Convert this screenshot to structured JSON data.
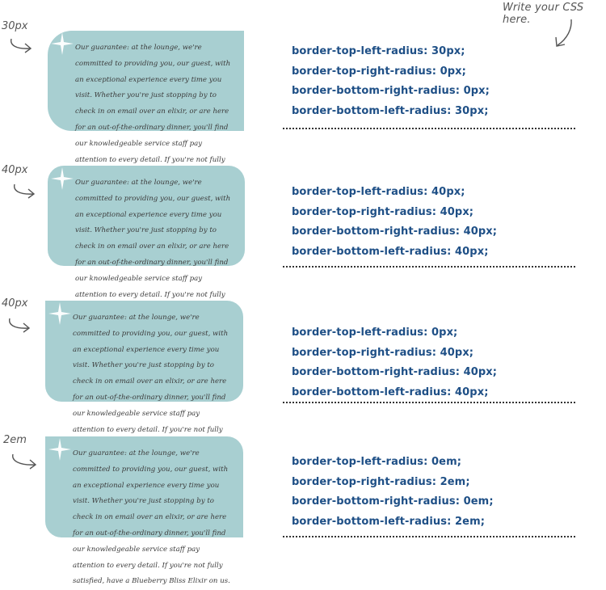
{
  "instruction": "Write your CSS here.",
  "guarantee_text": "Our guarantee: at the lounge, we're committed to providing you, our guest, with an exceptional experience every time you visit. Whether you're just stopping by to check in on email over an elixir, or are here for an out-of-the-ordinary dinner, you'll find our knowledgeable service staff pay attention to every detail. If you're not fully satisfied, have a Blueberry Bliss Elixir on us.",
  "examples": [
    {
      "label": "30px",
      "css": [
        "border-top-left-radius: 30px;",
        "border-top-right-radius: 0px;",
        "border-bottom-right-radius: 0px;",
        "border-bottom-left-radius: 30px;"
      ]
    },
    {
      "label": "40px",
      "css": [
        "border-top-left-radius: 40px;",
        "border-top-right-radius: 40px;",
        "border-bottom-right-radius: 40px;",
        "border-bottom-left-radius: 40px;"
      ]
    },
    {
      "label": "40px",
      "css": [
        "border-top-left-radius: 0px;",
        "border-top-right-radius: 40px;",
        "border-bottom-right-radius: 40px;",
        "border-bottom-left-radius: 40px;"
      ]
    },
    {
      "label": "2em",
      "css": [
        "border-top-left-radius: 0em;",
        "border-top-right-radius: 2em;",
        "border-bottom-right-radius: 0em;",
        "border-bottom-left-radius: 2em;"
      ]
    }
  ],
  "colors": {
    "card": "#a8cfd1",
    "code": "#1e4f86",
    "annotation": "#555555"
  },
  "icons": [
    "sparkle-icon",
    "hand-drawn-arrow-icon"
  ]
}
